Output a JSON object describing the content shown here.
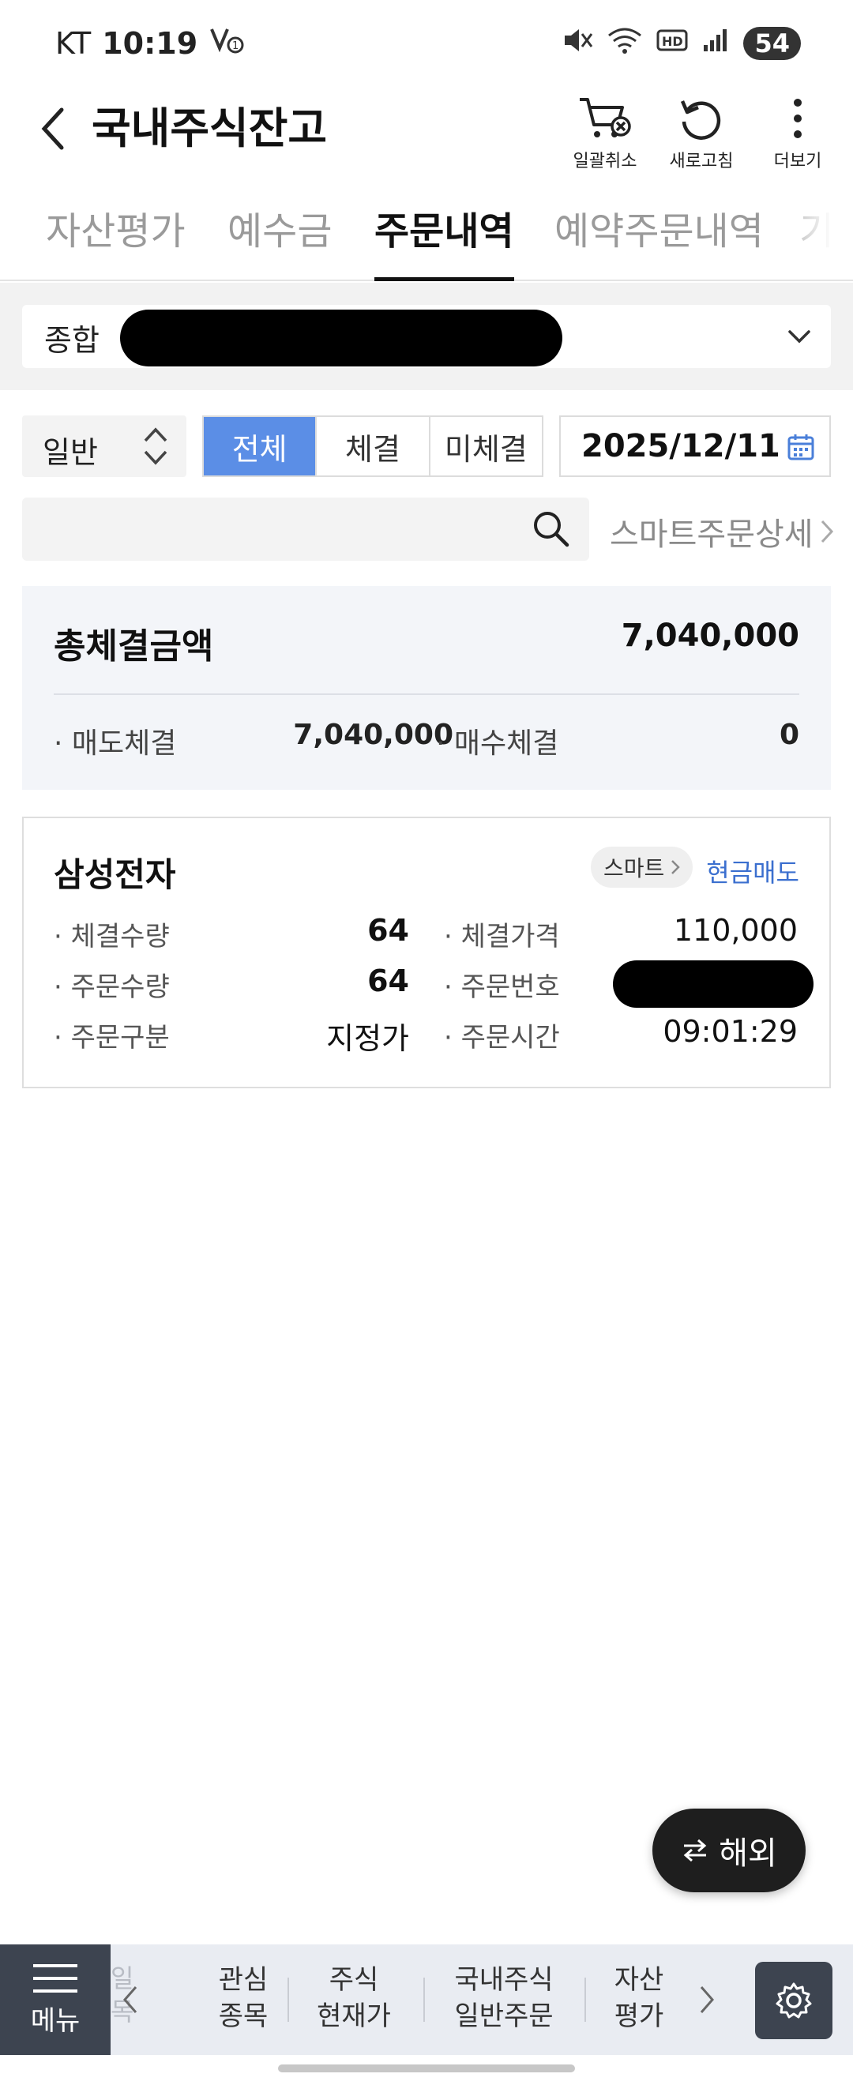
{
  "status_bar": {
    "carrier": "KT",
    "time": "10:19",
    "battery": "54"
  },
  "header": {
    "title": "국내주식잔고",
    "actions": [
      {
        "label": "일괄취소"
      },
      {
        "label": "새로고침"
      },
      {
        "label": "더보기"
      }
    ]
  },
  "tabs": [
    {
      "label": "자산평가"
    },
    {
      "label": "예수금"
    },
    {
      "label": "주문내역",
      "active": true
    },
    {
      "label": "예약주문내역"
    },
    {
      "label": "기"
    }
  ],
  "account": {
    "label": "종합"
  },
  "filters": {
    "type_select": "일반",
    "segments": [
      {
        "label": "전체",
        "active": true
      },
      {
        "label": "체결"
      },
      {
        "label": "미체결"
      }
    ],
    "date": "2025/12/11"
  },
  "search": {
    "placeholder": "",
    "smart_detail": "스마트주문상세"
  },
  "summary": {
    "title": "총체결금액",
    "total": "7,040,000",
    "sell_label": "· 매도체결",
    "sell_value": "7,040,000",
    "buy_label": "· 매수체결",
    "buy_value": "0"
  },
  "order": {
    "stock_name": "삼성전자",
    "smart_chip": "스마트",
    "order_type": "현금매도",
    "fields": {
      "filled_qty_label": "· 체결수량",
      "filled_qty": "64",
      "filled_price_label": "· 체결가격",
      "filled_price": "110,000",
      "order_qty_label": "· 주문수량",
      "order_qty": "64",
      "order_no_label": "· 주문번호",
      "order_kind_label": "· 주문구분",
      "order_kind": "지정가",
      "order_time_label": "· 주문시간",
      "order_time": "09:01:29"
    }
  },
  "floating": {
    "overseas": "해외"
  },
  "bottom_nav": {
    "menu": "메뉴",
    "ghost": "일\n목",
    "items": [
      {
        "label": "관심\n종목"
      },
      {
        "label": "주식\n현재가"
      },
      {
        "label": "국내주식\n일반주문"
      },
      {
        "label": "자산\n평가"
      }
    ]
  }
}
